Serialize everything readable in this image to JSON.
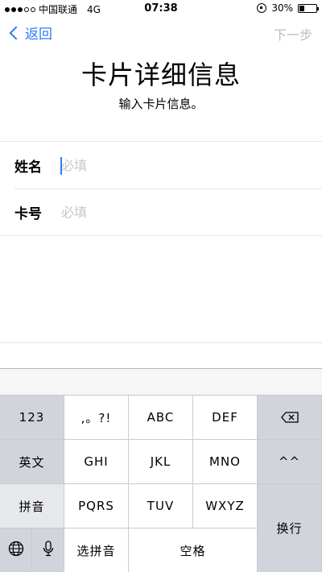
{
  "status_bar": {
    "carrier": "中国联通",
    "network": "4G",
    "time": "07:38",
    "battery": "30%",
    "battery_level": 0.3
  },
  "nav": {
    "back_label": "返回",
    "next_label": "下一步"
  },
  "header": {
    "title": "卡片详细信息",
    "subtitle": "输入卡片信息。"
  },
  "form": {
    "fields": [
      {
        "label": "姓名",
        "placeholder": "必填",
        "value": ""
      },
      {
        "label": "卡号",
        "placeholder": "必填",
        "value": ""
      }
    ]
  },
  "keyboard": {
    "row1": [
      "123",
      ",。?!",
      "ABC",
      "DEF"
    ],
    "row2": [
      "英文",
      "GHI",
      "JKL",
      "MNO",
      "^^"
    ],
    "row3": [
      "拼音",
      "PQRS",
      "TUV",
      "WXYZ"
    ],
    "row4": [
      "选拼音",
      "空格"
    ],
    "enter_label": "换行"
  },
  "colors": {
    "accent": "#2f7bf5",
    "disabled": "#bcbcbc",
    "keyboard_bg": "#d1d5db"
  }
}
